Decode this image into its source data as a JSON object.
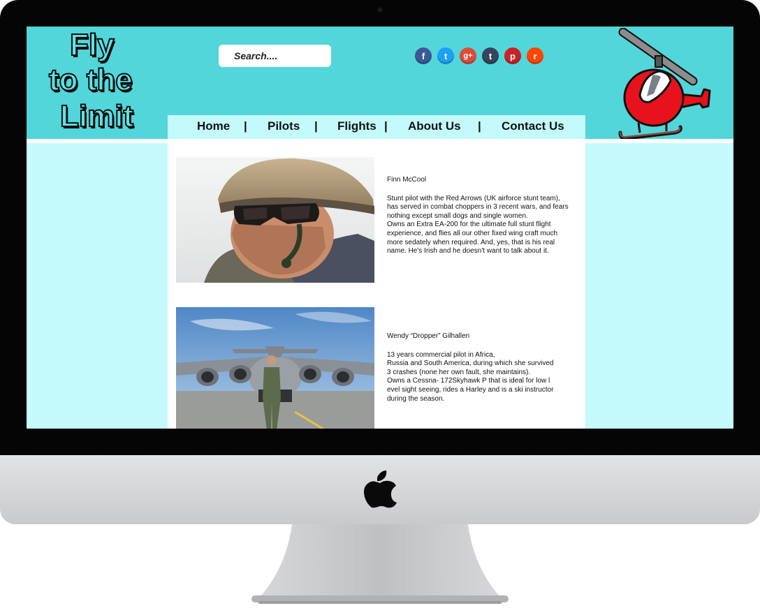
{
  "site": {
    "logo_lines": [
      "Fly",
      "to the",
      "Limit"
    ],
    "search_placeholder": "Search....",
    "social_icons": [
      {
        "name": "facebook-icon",
        "glyph": "f",
        "color": "#3b5998"
      },
      {
        "name": "twitter-icon",
        "glyph": "t",
        "color": "#1da1f2"
      },
      {
        "name": "google-plus-icon",
        "glyph": "g+",
        "color": "#dd4b39"
      },
      {
        "name": "tumblr-icon",
        "glyph": "t",
        "color": "#35465c"
      },
      {
        "name": "pinterest-icon",
        "glyph": "p",
        "color": "#cb2027"
      },
      {
        "name": "reddit-icon",
        "glyph": "r",
        "color": "#ff4500"
      }
    ],
    "nav": {
      "home": "Home",
      "pilots": "Pilots",
      "flights": "Flights",
      "about": "About Us",
      "contact": "Contact Us",
      "separator": "|"
    }
  },
  "pilots": [
    {
      "name": "Finn McCool",
      "bio": "Stunt pilot with the Red Arrows (UK airforce stunt team),\nhas served in combat choppers in 3 recent wars, and fears\nnothing except small dogs and single women.\nOwns an Extra EA-200 for the ultimate full stunt flight\nexperience, and flies all our other fixed wing craft much\nmore sedately when required. And, yes, that is his real\nname. He's Irish and he doesn't want to talk about it."
    },
    {
      "name": "Wendy “Dropper” Gilhallen",
      "bio": "13 years commercial pilot in Africa,\nRussia and South America, during which she survived\n3 crashes (none her own fault, she maintains).\nOwns a Cessna- 172Skyhawk P that is ideal for low l\nevel sight seeing, rides a Harley and is a ski instructor\nduring the season."
    }
  ],
  "colors": {
    "header": "#52d6da",
    "page_bg": "#c4fafb",
    "content_bg": "#ffffff"
  }
}
